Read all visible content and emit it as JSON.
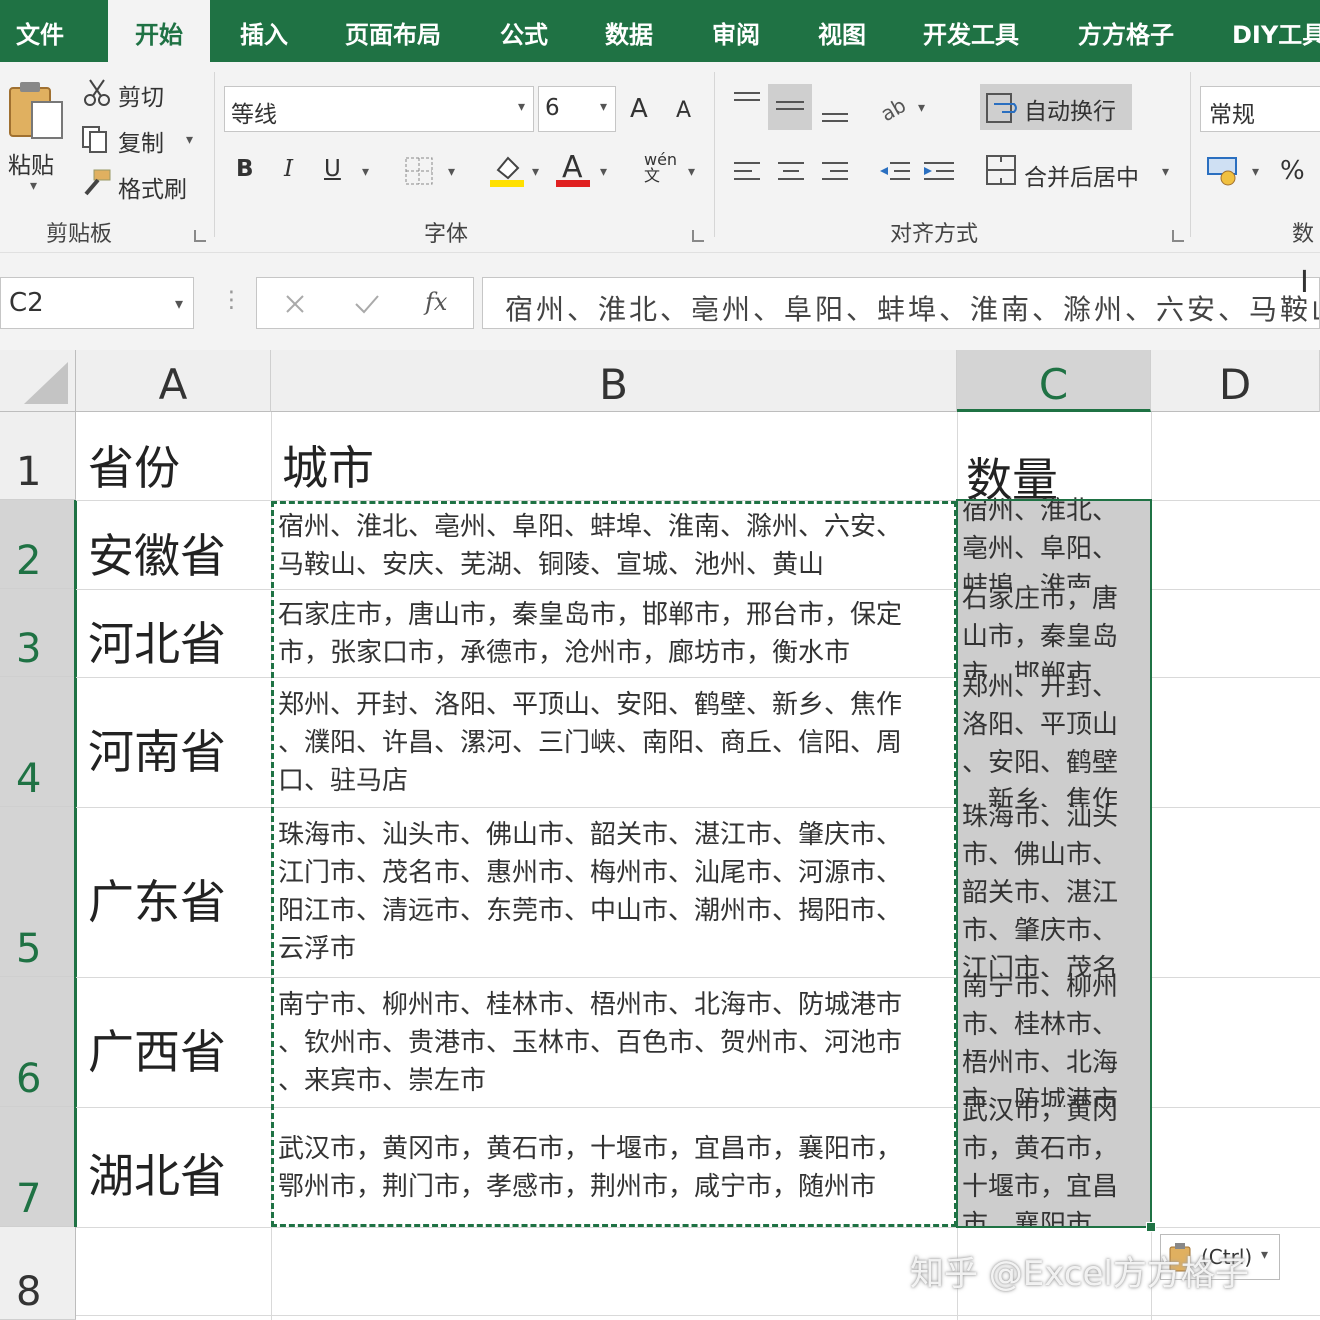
{
  "menu": {
    "tabs": [
      "文件",
      "开始",
      "插入",
      "页面布局",
      "公式",
      "数据",
      "审阅",
      "视图",
      "开发工具",
      "方方格子",
      "DIY工具"
    ],
    "active": "开始"
  },
  "ribbon": {
    "clipboard": {
      "paste": "粘贴",
      "cut": "剪切",
      "copy": "复制",
      "format_painter": "格式刷",
      "group_label": "剪贴板"
    },
    "font": {
      "font_name": "等线",
      "font_size": "6",
      "bold": "B",
      "italic": "I",
      "underline": "U",
      "increase": "A",
      "decrease": "A",
      "color_letter": "A",
      "phonetic": "wén 文",
      "group_label": "字体"
    },
    "alignment": {
      "wrap_text": "自动换行",
      "merge_center": "合并后居中",
      "group_label": "对齐方式"
    },
    "number": {
      "format": "常规",
      "percent": "%",
      "group_label": "数"
    }
  },
  "formula_bar": {
    "name_box": "C2",
    "fx": "fx",
    "content": "宿州、淮北、亳州、阜阳、蚌埠、淮南、滁州、六安、马鞍山、"
  },
  "sheet": {
    "columns": [
      "A",
      "B",
      "C",
      "D"
    ],
    "row_numbers": [
      "1",
      "2",
      "3",
      "4",
      "5",
      "6",
      "7",
      "8"
    ],
    "header": {
      "a": "省份",
      "b": "城市",
      "c": "数量"
    },
    "rows": [
      {
        "province": "安徽省",
        "cities": "宿州、淮北、亳州、阜阳、蚌埠、淮南、滁州、六安、\n马鞍山、安庆、芜湖、铜陵、宣城、池州、黄山",
        "count": "宿州、淮北、\n亳州、阜阳、\n蚌埠、淮南"
      },
      {
        "province": "河北省",
        "cities": "石家庄市，唐山市，秦皇岛市，邯郸市，邢台市，保定\n市，张家口市，承德市，沧州市，廊坊市，衡水市",
        "count": "石家庄市，唐\n山市，秦皇岛\n市，邯郸市"
      },
      {
        "province": "河南省",
        "cities": "郑州、开封、洛阳、平顶山、安阳、鹤壁、新乡、焦作\n、濮阳、许昌、漯河、三门峡、南阳、商丘、信阳、周\n口、驻马店",
        "count": "郑州、开封、\n洛阳、平顶山\n、安阳、鹤壁\n、新乡、焦作"
      },
      {
        "province": "广东省",
        "cities": "珠海市、汕头市、佛山市、韶关市、湛江市、肇庆市、\n江门市、茂名市、惠州市、梅州市、汕尾市、河源市、\n阳江市、清远市、东莞市、中山市、潮州市、揭阳市、\n云浮市",
        "count": "珠海市、汕头\n市、佛山市、\n韶关市、湛江\n市、肇庆市、\n江门市、茂名"
      },
      {
        "province": "广西省",
        "cities": "南宁市、柳州市、桂林市、梧州市、北海市、防城港市\n、钦州市、贵港市、玉林市、百色市、贺州市、河池市\n、来宾市、崇左市",
        "count": "南宁市、柳州\n市、桂林市、\n梧州市、北海\n市、防城港市"
      },
      {
        "province": "湖北省",
        "cities": "武汉市，黄冈市，黄石市，十堰市，宜昌市，襄阳市，\n鄂州市，荆门市，孝感市，荆州市，咸宁市，随州市",
        "count": "武汉市，黄冈\n市，黄石市，\n十堰市，宜昌\n市，襄阳市"
      }
    ],
    "paste_options": "(Ctrl)"
  },
  "watermark": "知乎 @Excel方方格子",
  "colors": {
    "excel_green": "#1f7244",
    "ribbon_bg": "#f3f3f3",
    "selected_range": "#cdcdcd"
  }
}
